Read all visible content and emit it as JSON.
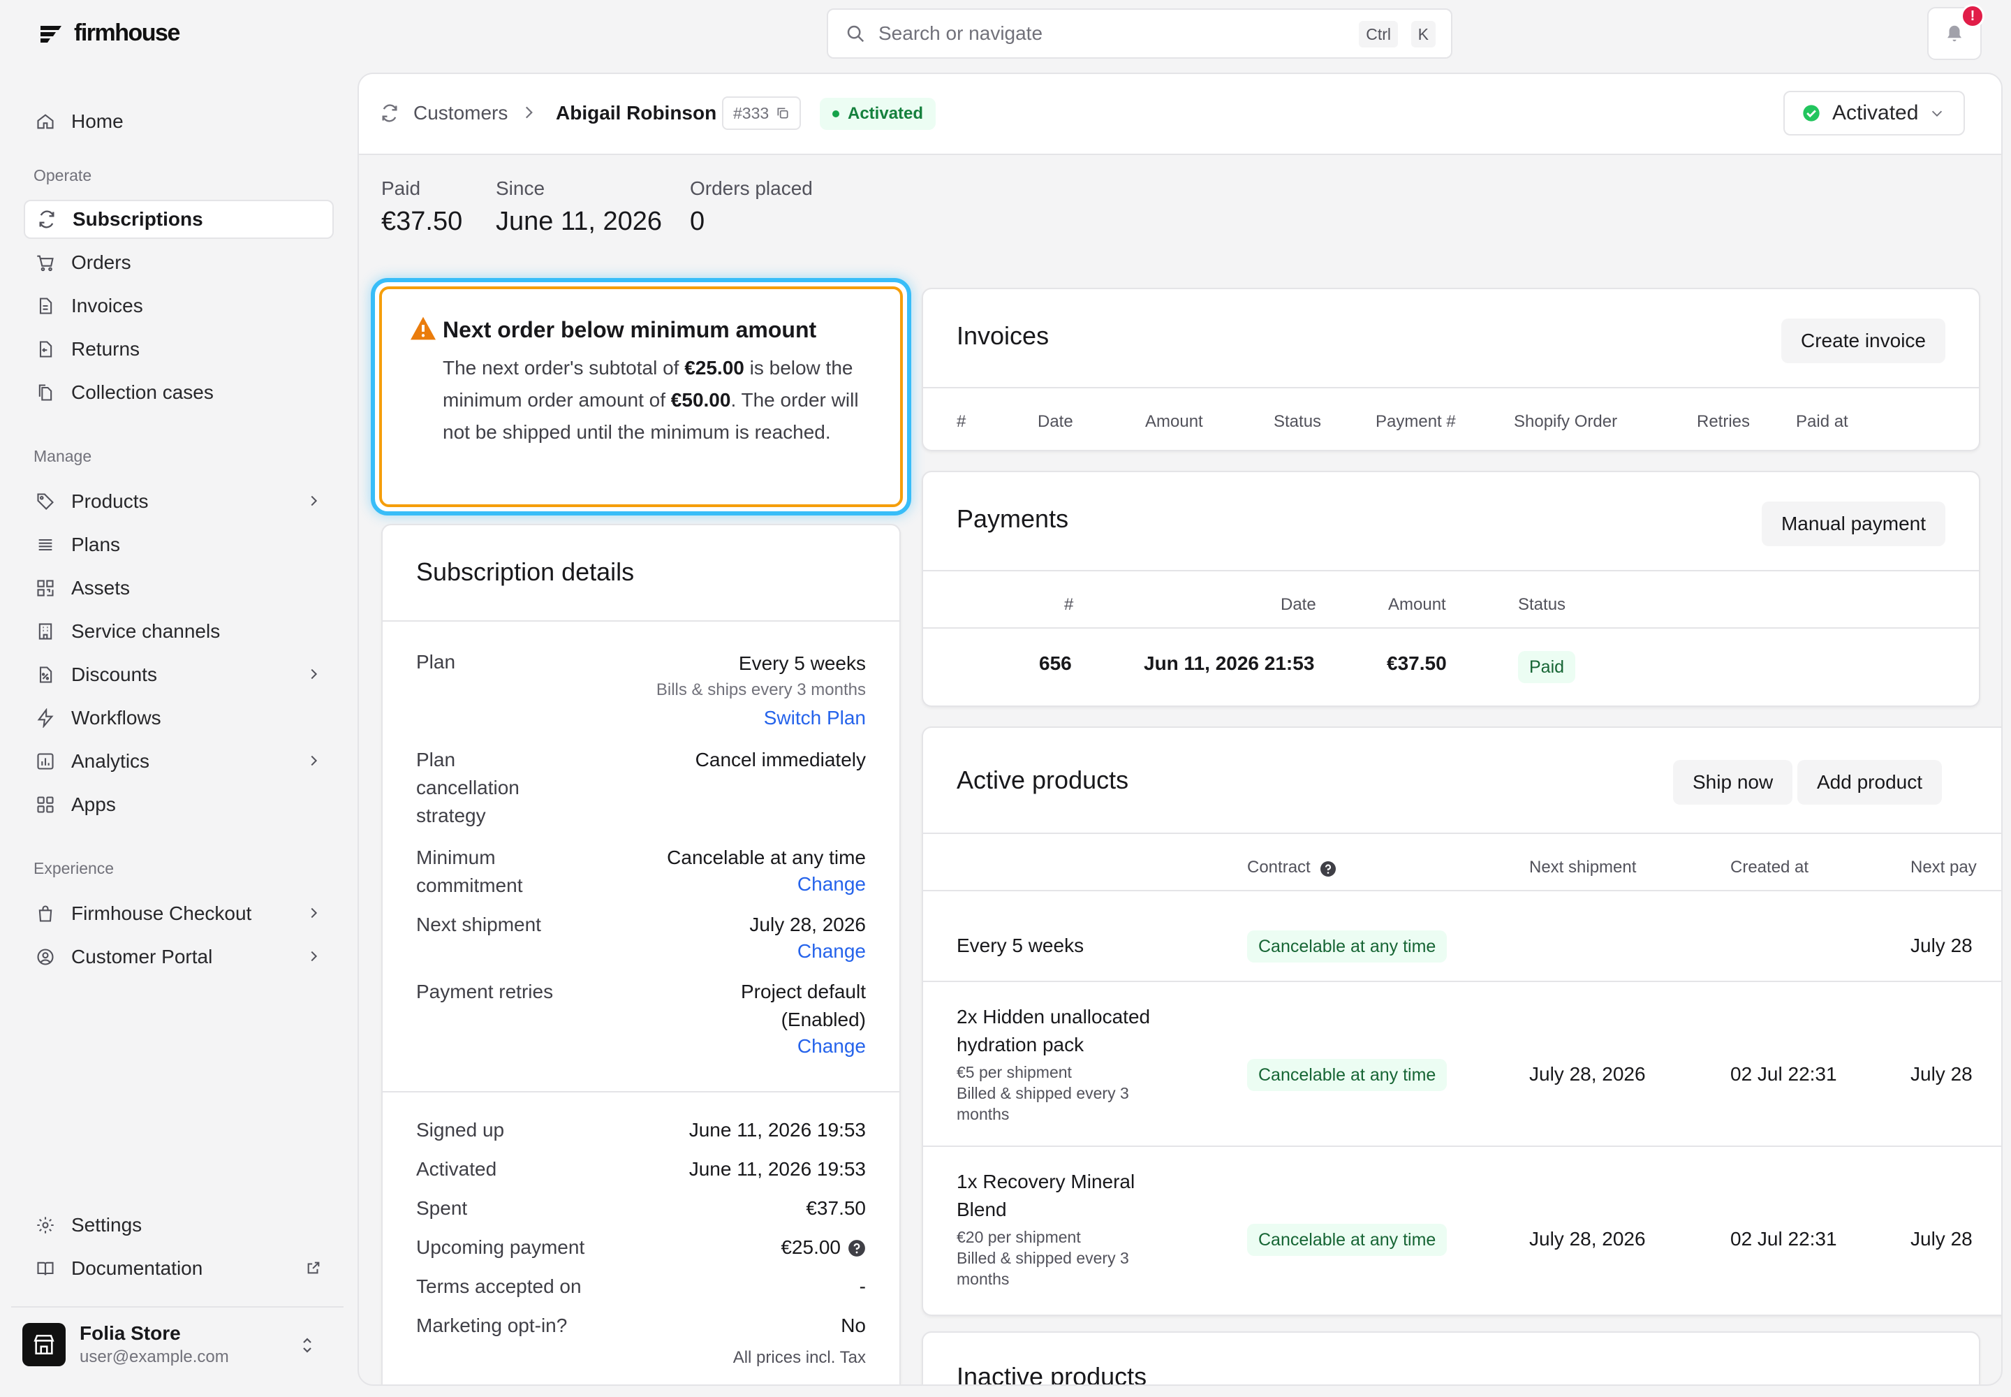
{
  "brand": {
    "name": "firmhouse"
  },
  "sidebar": {
    "home": "Home",
    "sections": {
      "operate": "Operate",
      "manage": "Manage",
      "experience": "Experience"
    },
    "operate": [
      "Subscriptions",
      "Orders",
      "Invoices",
      "Returns",
      "Collection cases"
    ],
    "manage": [
      "Products",
      "Plans",
      "Assets",
      "Service channels",
      "Discounts",
      "Workflows",
      "Analytics",
      "Apps"
    ],
    "experience": [
      "Firmhouse Checkout",
      "Customer Portal"
    ],
    "settings": "Settings",
    "documentation": "Documentation",
    "store": {
      "name": "Folia Store",
      "email": "user@example.com"
    }
  },
  "topbar": {
    "search_placeholder": "Search or navigate",
    "kbd_ctrl": "Ctrl",
    "kbd_k": "K",
    "notification_badge": "!"
  },
  "header": {
    "breadcrumb_parent": "Customers",
    "customer_name": "Abigail Robinson",
    "customer_id": "#333",
    "status_badge": "Activated",
    "status_select": "Activated"
  },
  "stats": [
    {
      "label": "Paid",
      "value": "€37.50"
    },
    {
      "label": "Since",
      "value": "June 11, 2026"
    },
    {
      "label": "Orders placed",
      "value": "0"
    }
  ],
  "warning": {
    "title": "Next order below minimum amount",
    "text_1": "The next order's subtotal of ",
    "amount": "€25.00",
    "text_2": " is below the minimum order amount of ",
    "minimum": "€50.00",
    "text_3": ". The order will not be shipped until the minimum is reached."
  },
  "subscription_details": {
    "title": "Subscription details",
    "plan_label": "Plan",
    "plan_value": "Every 5 weeks",
    "plan_sub": "Bills & ships every 3 months",
    "switch_plan": "Switch Plan",
    "cancellation_label": "Plan cancellation strategy",
    "cancellation_value": "Cancel immediately",
    "minimum_label": "Minimum commitment",
    "minimum_value": "Cancelable at any time",
    "next_shipment_label": "Next shipment",
    "next_shipment_value": "July 28, 2026",
    "retries_label": "Payment retries",
    "retries_value_1": "Project default",
    "retries_value_2": "(Enabled)",
    "change": "Change",
    "rows": [
      {
        "label": "Signed up",
        "value": "June 11, 2026 19:53"
      },
      {
        "label": "Activated",
        "value": "June 11, 2026 19:53"
      },
      {
        "label": "Spent",
        "value": "€37.50"
      },
      {
        "label": "Upcoming payment",
        "value": "€25.00"
      },
      {
        "label": "Terms accepted on",
        "value": "-"
      },
      {
        "label": "Marketing opt-in?",
        "value": "No"
      }
    ],
    "footnote": "All prices incl. Tax"
  },
  "invoices": {
    "title": "Invoices",
    "create_button": "Create invoice",
    "columns": [
      "#",
      "Date",
      "Amount",
      "Status",
      "Payment #",
      "Shopify Order",
      "Retries",
      "Paid at"
    ]
  },
  "payments": {
    "title": "Payments",
    "manual_button": "Manual payment",
    "columns": [
      "#",
      "Date",
      "Amount",
      "Status"
    ],
    "rows": [
      {
        "id": "656",
        "date": "Jun 11, 2026 21:53",
        "amount": "€37.50",
        "status": "Paid"
      }
    ]
  },
  "active_products": {
    "title": "Active products",
    "ship_now": "Ship now",
    "add_product": "Add product",
    "columns": [
      "Contract",
      "Next shipment",
      "Created at",
      "Next pay"
    ],
    "rows": [
      {
        "name": "Every 5 weeks",
        "contract": "Cancelable at any time",
        "next_shipment": "",
        "created_at": "",
        "next_pay": "July 28"
      },
      {
        "name": "2x Hidden unallocated hydration pack",
        "price": "€5 per shipment",
        "billing": "Billed & shipped every 3 months",
        "contract": "Cancelable at any time",
        "next_shipment": "July 28, 2026",
        "created_at": "02 Jul 22:31",
        "next_pay": "July 28"
      },
      {
        "name": "1x Recovery Mineral Blend",
        "price": "€20 per shipment",
        "billing": "Billed & shipped every 3 months",
        "contract": "Cancelable at any time",
        "next_shipment": "July 28, 2026",
        "created_at": "02 Jul 22:31",
        "next_pay": "July 28"
      }
    ]
  },
  "inactive_products": {
    "title": "Inactive products"
  },
  "colors": {
    "accent_blue": "#2563eb",
    "success": "#16a34a",
    "warning": "#f59e0b",
    "focus": "#38bdf8",
    "badge": "#e11d48"
  }
}
